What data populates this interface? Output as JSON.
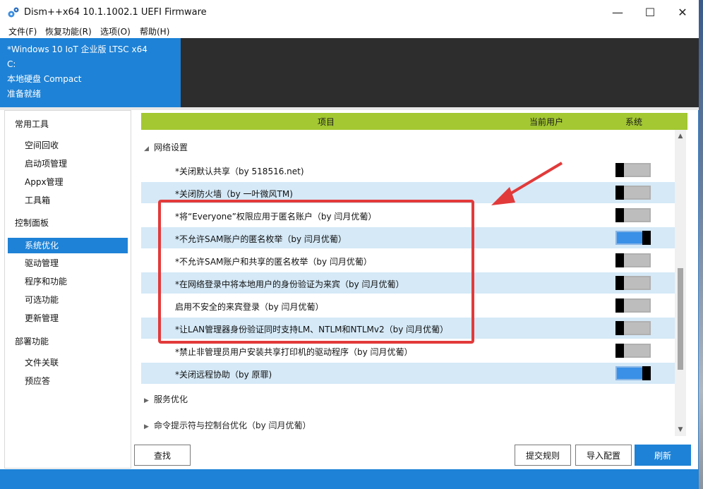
{
  "window": {
    "title": "Dism++x64 10.1.1002.1 UEFI Firmware",
    "controls": {
      "minimize": "—",
      "maximize": "☐",
      "close": "✕"
    }
  },
  "menu": [
    "文件(F)",
    "恢复功能(R)",
    "选项(O)",
    "帮助(H)"
  ],
  "info": {
    "os": "*Windows 10 IoT 企业版 LTSC x64",
    "drive": "C:",
    "disk": "本地硬盘 Compact",
    "status": "准备就绪"
  },
  "sidebar": {
    "categories": [
      {
        "label": "常用工具",
        "items": [
          "空间回收",
          "启动项管理",
          "Appx管理",
          "工具箱"
        ]
      },
      {
        "label": "控制面板",
        "items": [
          "系统优化",
          "驱动管理",
          "程序和功能",
          "可选功能",
          "更新管理"
        ]
      },
      {
        "label": "部署功能",
        "items": [
          "文件关联",
          "预应答"
        ]
      }
    ],
    "active": "系统优化"
  },
  "table": {
    "headers": {
      "item": "项目",
      "current_user": "当前用户",
      "system": "系统"
    },
    "group_expanded": "网络设置",
    "rows": [
      {
        "label": "*关闭默认共享（by 518516.net)",
        "on": false
      },
      {
        "label": "*关闭防火墙（by 一叶微风TM)",
        "on": false
      },
      {
        "label": "*将“Everyone”权限应用于匿名账户（by 闫月优葡）",
        "on": false
      },
      {
        "label": "*不允许SAM账户的匿名枚举（by 闫月优葡）",
        "on": true
      },
      {
        "label": "*不允许SAM账户和共享的匿名枚举（by 闫月优葡）",
        "on": false
      },
      {
        "label": "*在网络登录中将本地用户的身份验证为来宾（by 闫月优葡）",
        "on": false
      },
      {
        "label": "启用不安全的来宾登录（by 闫月优葡）",
        "on": false
      },
      {
        "label": "*让LAN管理器身份验证同时支持LM、NTLM和NTLMv2（by 闫月优葡）",
        "on": false
      },
      {
        "label": "*禁止非管理员用户安装共享打印机的驱动程序（by 闫月优葡）",
        "on": false
      },
      {
        "label": "*关闭远程协助（by 原罪)",
        "on": true
      }
    ],
    "groups_collapsed": [
      "服务优化",
      "命令提示符与控制台优化（by 闫月优葡）"
    ]
  },
  "buttons": {
    "find": "查找",
    "submit_rules": "提交规则",
    "import_config": "导入配置",
    "refresh": "刷新"
  },
  "colors": {
    "accent": "#1e82d6",
    "header_green": "#a3c832",
    "row_alt": "#d5e9f7",
    "highlight": "#e23a3a"
  }
}
